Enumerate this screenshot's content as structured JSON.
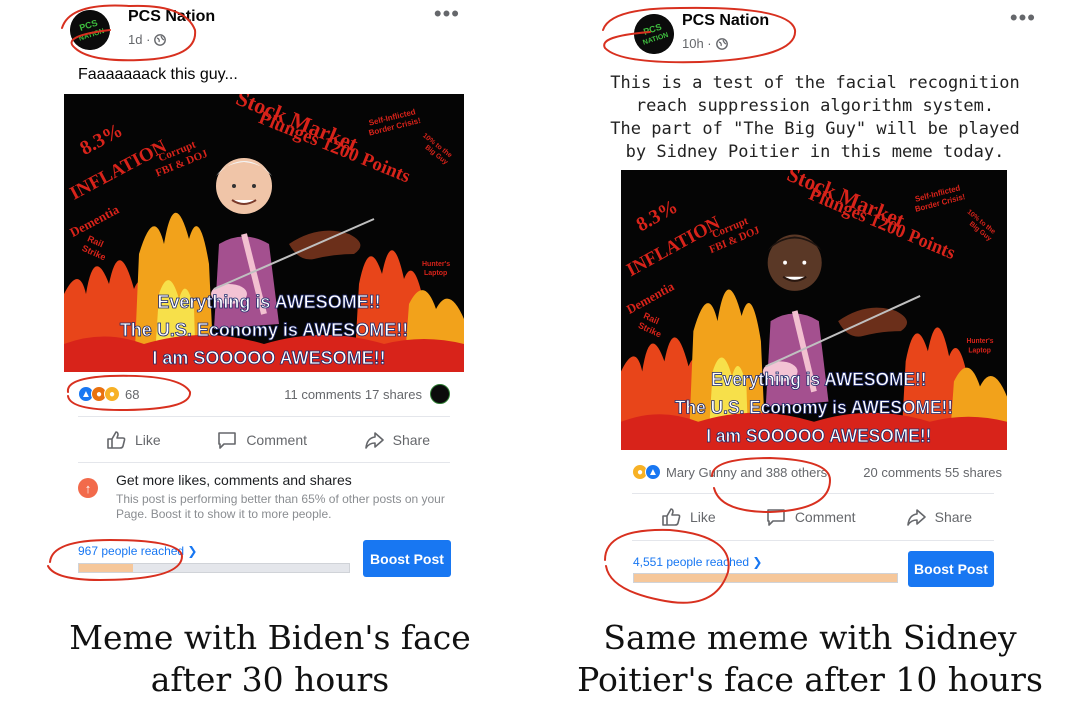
{
  "left": {
    "page_name": "PCS Nation",
    "avatar_text": [
      "PCS",
      "NATION"
    ],
    "time": "1d ·",
    "caption": "Faaaaaaack this guy...",
    "meme": {
      "top_words": [
        "8.3%",
        "INFLATION",
        "Corrupt",
        "FBI & DOJ",
        "Stock Market",
        "Plunges 1200 Points",
        "Self-Inflicted",
        "Border Crisis!",
        "10% to the",
        "Big Guy",
        "Dementia",
        "Rail",
        "Strike",
        "Hunter's",
        "Laptop"
      ],
      "slogan": [
        "Everything is AWESOME!!",
        "The U.S. Economy is AWESOME!!",
        "I am SOOOOO AWESOME!!"
      ]
    },
    "reaction_count": "68",
    "comments_shares": "11 comments 17 shares",
    "actions": {
      "like": "Like",
      "comment": "Comment",
      "share": "Share"
    },
    "promo": {
      "title": "Get more likes, comments and shares",
      "body": "This post is performing better than 65% of other posts on your Page. Boost it to show it to more people."
    },
    "reach_text": "967 people reached ❯",
    "reach_fraction": 0.2,
    "boost_label": "Boost Post"
  },
  "right": {
    "page_name": "PCS Nation",
    "avatar_text": [
      "PCS",
      "NATION"
    ],
    "time": "10h ·",
    "caption_lines": [
      "This is a test of the facial recognition",
      "reach suppression algorithm system.",
      "The part of \"The Big Guy\" will be played",
      "by Sidney Poitier in this meme today."
    ],
    "meme": {
      "top_words": [
        "8.3%",
        "INFLATION",
        "Corrupt",
        "FBI & DOJ",
        "Stock Market",
        "Plunges 1200 Points",
        "Self-Inflicted",
        "Border Crisis!",
        "10% to the",
        "Big Guy",
        "Dementia",
        "Rail",
        "Strike",
        "Hunter's",
        "Laptop"
      ],
      "slogan": [
        "Everything is AWESOME!!",
        "The U.S. Economy is AWESOME!!",
        "I am SOOOOO AWESOME!!"
      ]
    },
    "reaction_names": "Mary Gunny and 388 others",
    "comments_shares": "20 comments 55 shares",
    "actions": {
      "like": "Like",
      "comment": "Comment",
      "share": "Share"
    },
    "reach_text": "4,551 people reached ❯",
    "reach_fraction": 1.0,
    "boost_label": "Boost Post"
  },
  "bottom": {
    "left_caption": [
      "Meme with Biden's face",
      "after 30 hours"
    ],
    "right_caption": [
      "Same meme with Sidney",
      "Poitier's face after 10 hours"
    ]
  },
  "colors": {
    "facebook_blue": "#1877f2",
    "meme_red": "#d8231a",
    "annotation_red": "#d8301f",
    "reach_fill": "#f6c79a"
  },
  "icons": [
    "globe-icon",
    "more-icon",
    "like-icon",
    "comment-icon",
    "share-icon",
    "boost-arrow-icon"
  ]
}
